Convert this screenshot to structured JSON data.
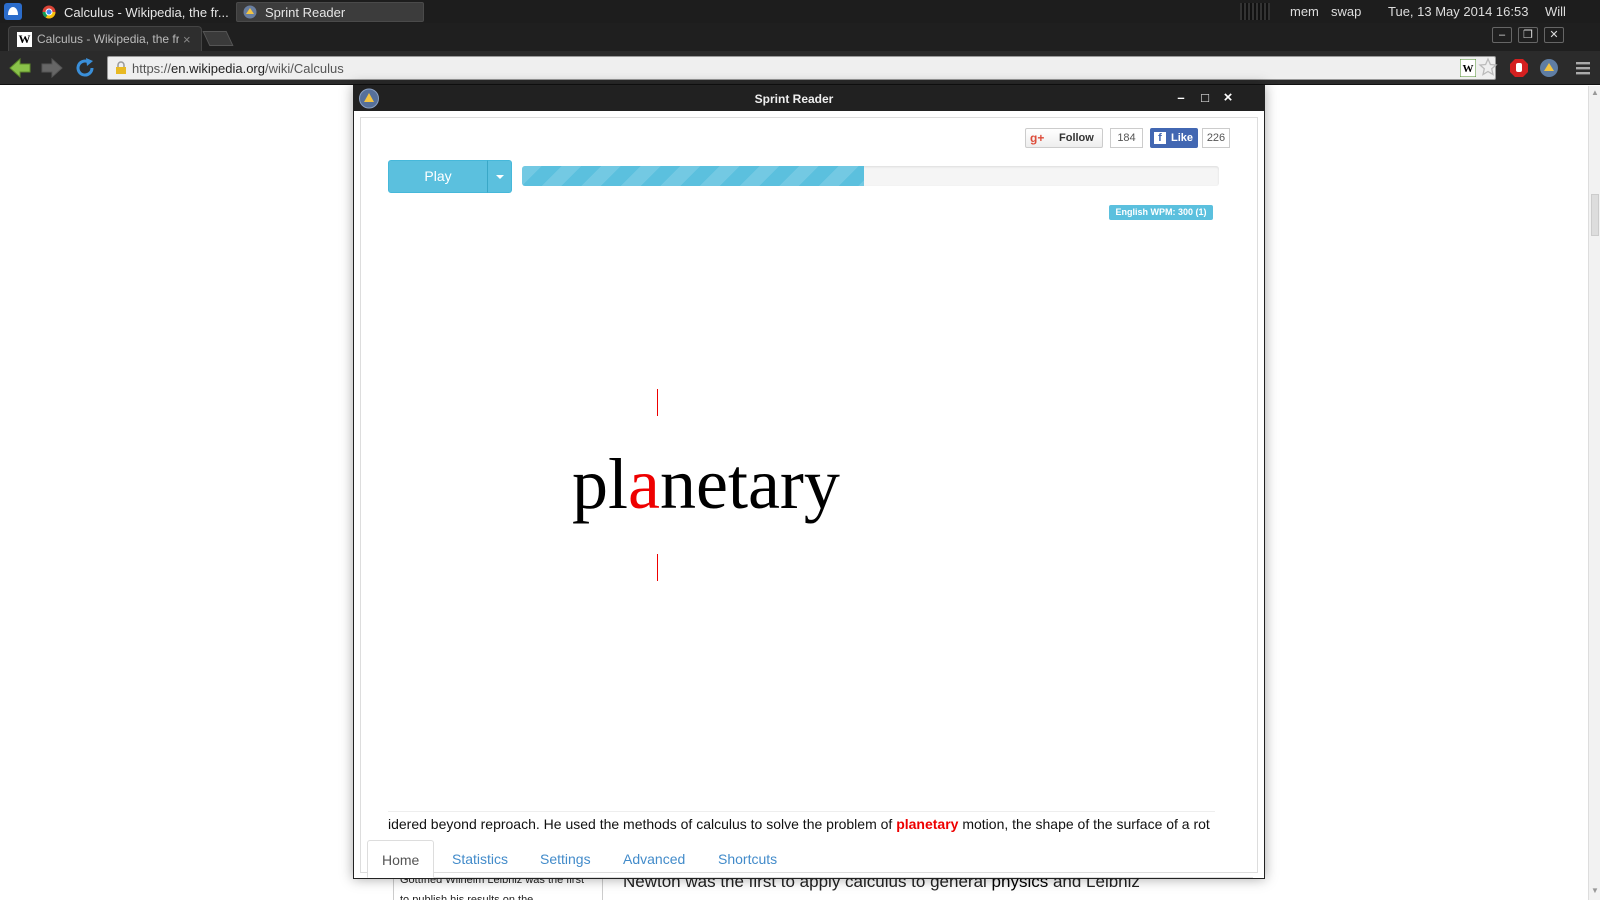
{
  "panel": {
    "tasks": [
      {
        "title": "Calculus - Wikipedia, the fr..."
      },
      {
        "title": "Sprint Reader"
      }
    ],
    "mem_label": "mem",
    "swap_label": "swap",
    "clock": "Tue, 13 May 2014 16:53",
    "user": "Will"
  },
  "browser": {
    "tab_title": "Calculus - Wikipedia, the fr",
    "tab_favicon": "W",
    "tab_close": "×",
    "url_scheme": "https://",
    "url_host": "en.wikipedia.org",
    "url_path": "/wiki/Calculus"
  },
  "window": {
    "title": "Sprint Reader",
    "minimize": "–",
    "maximize": "□",
    "close": "×"
  },
  "social": {
    "gplus_icon": "g+",
    "gplus_label": "Follow",
    "gplus_count": "184",
    "fb_icon": "f",
    "fb_label": "Like",
    "fb_count": "226"
  },
  "reader": {
    "play_label": "Play",
    "progress_fraction": 0.49,
    "wpm_badge": "English WPM: 300 (1)",
    "word_pre": "pl",
    "word_orp": "a",
    "word_post": "netary",
    "context_before": "idered beyond reproach. He used the methods of calculus to solve the problem of ",
    "context_word": "planetary",
    "context_after": " motion, the shape of the surface of a rot"
  },
  "tabs": [
    {
      "label": "Home"
    },
    {
      "label": "Statistics"
    },
    {
      "label": "Settings"
    },
    {
      "label": "Advanced"
    },
    {
      "label": "Shortcuts"
    }
  ],
  "wiki": {
    "sidebox_text": "Gottfried Wilhelm Leibniz was the first to publish his results on the",
    "para_before": "Newton was the first to apply calculus to general ",
    "para_bold": "physics",
    "para_after": " and Leibniz"
  },
  "colors": {
    "accent": "#5bc0de",
    "orp_red": "#e00000",
    "link_blue": "#428bca",
    "fb_blue": "#4267b2"
  }
}
